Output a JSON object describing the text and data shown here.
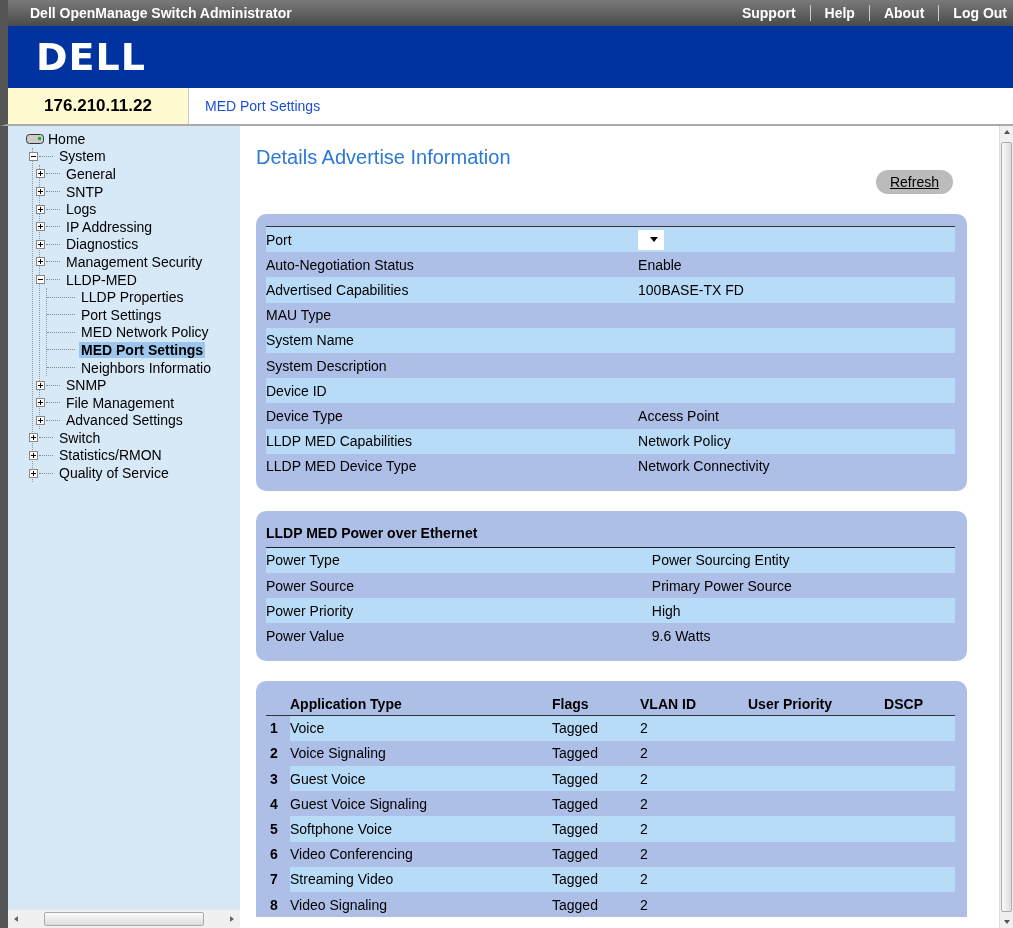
{
  "window": {
    "title": "Dell OpenManage Switch Administrator"
  },
  "top_links": [
    "Support",
    "Help",
    "About",
    "Log Out"
  ],
  "logo": {
    "text": "DELL"
  },
  "address": "176.210.11.22",
  "breadcrumb": "MED Port Settings",
  "sidebar": {
    "items": [
      {
        "label": "Home",
        "kind": "root",
        "selected": false,
        "children": [
          {
            "label": "System",
            "kind": "folder",
            "expanded": true,
            "selected": false,
            "children": [
              {
                "label": "General",
                "kind": "folder",
                "expanded": false,
                "selected": false
              },
              {
                "label": "SNTP",
                "kind": "folder",
                "expanded": false,
                "selected": false
              },
              {
                "label": "Logs",
                "kind": "folder",
                "expanded": false,
                "selected": false
              },
              {
                "label": "IP Addressing",
                "kind": "folder",
                "expanded": false,
                "selected": false
              },
              {
                "label": "Diagnostics",
                "kind": "folder",
                "expanded": false,
                "selected": false
              },
              {
                "label": "Management Security",
                "kind": "folder",
                "expanded": false,
                "selected": false
              },
              {
                "label": "LLDP-MED",
                "kind": "folder",
                "expanded": true,
                "selected": false,
                "children": [
                  {
                    "label": "LLDP Properties",
                    "kind": "leaf",
                    "selected": false
                  },
                  {
                    "label": "Port Settings",
                    "kind": "leaf",
                    "selected": false
                  },
                  {
                    "label": "MED Network Policy",
                    "kind": "leaf",
                    "selected": false
                  },
                  {
                    "label": "MED Port Settings",
                    "kind": "leaf",
                    "selected": true
                  },
                  {
                    "label": "Neighbors Informatio",
                    "kind": "leaf",
                    "selected": false
                  }
                ]
              },
              {
                "label": "SNMP",
                "kind": "folder",
                "expanded": false,
                "selected": false
              },
              {
                "label": "File Management",
                "kind": "folder",
                "expanded": false,
                "selected": false
              },
              {
                "label": "Advanced Settings",
                "kind": "folder",
                "expanded": false,
                "selected": false
              }
            ]
          },
          {
            "label": "Switch",
            "kind": "folder",
            "expanded": false,
            "selected": false
          },
          {
            "label": "Statistics/RMON",
            "kind": "folder",
            "expanded": false,
            "selected": false
          },
          {
            "label": "Quality of Service",
            "kind": "folder",
            "expanded": false,
            "selected": false
          }
        ]
      }
    ]
  },
  "page": {
    "title": "Details Advertise Information",
    "refresh_button": "Refresh"
  },
  "advertise": [
    {
      "label": "Port",
      "kind": "select"
    },
    {
      "label": "Auto-Negotiation Status",
      "kind": "text",
      "value": "Enable"
    },
    {
      "label": "Advertised Capabilities",
      "kind": "text",
      "value": "100BASE-TX FD"
    },
    {
      "label": "MAU Type",
      "kind": "text"
    },
    {
      "label": "System Name",
      "kind": "text"
    },
    {
      "label": "System Description",
      "kind": "text"
    },
    {
      "label": "Device ID",
      "kind": "text"
    },
    {
      "label": "Device Type",
      "kind": "text",
      "value": "Access Point"
    },
    {
      "label": "LLDP MED Capabilities",
      "kind": "text",
      "value": "Network Policy"
    },
    {
      "label": "LLDP MED Device Type",
      "kind": "text",
      "value": "Network Connectivity"
    }
  ],
  "poe": {
    "title": "LLDP MED Power over Ethernet",
    "rows": [
      {
        "label": "Power Type",
        "value": "Power Sourcing Entity"
      },
      {
        "label": "Power Source",
        "value": "Primary Power Source"
      },
      {
        "label": "Power Priority",
        "value": "High"
      },
      {
        "label": "Power Value",
        "value": "9.6 Watts"
      }
    ]
  },
  "policy_table": {
    "columns": [
      "Application Type",
      "Flags",
      "VLAN ID",
      "User Priority",
      "DSCP"
    ],
    "rows": [
      {
        "index": "1",
        "type": "Voice",
        "flags": "Tagged",
        "vlan": "2"
      },
      {
        "index": "2",
        "type": "Voice Signaling",
        "flags": "Tagged",
        "vlan": "2"
      },
      {
        "index": "3",
        "type": "Guest Voice",
        "flags": "Tagged",
        "vlan": "2"
      },
      {
        "index": "4",
        "type": "Guest Voice Signaling",
        "flags": "Tagged",
        "vlan": "2"
      },
      {
        "index": "5",
        "type": "Softphone Voice",
        "flags": "Tagged",
        "vlan": "2"
      },
      {
        "index": "6",
        "type": "Video Conferencing",
        "flags": "Tagged",
        "vlan": "2"
      },
      {
        "index": "7",
        "type": "Streaming Video",
        "flags": "Tagged",
        "vlan": "2"
      },
      {
        "index": "8",
        "type": "Video Signaling",
        "flags": "Tagged",
        "vlan": "2"
      }
    ]
  }
}
